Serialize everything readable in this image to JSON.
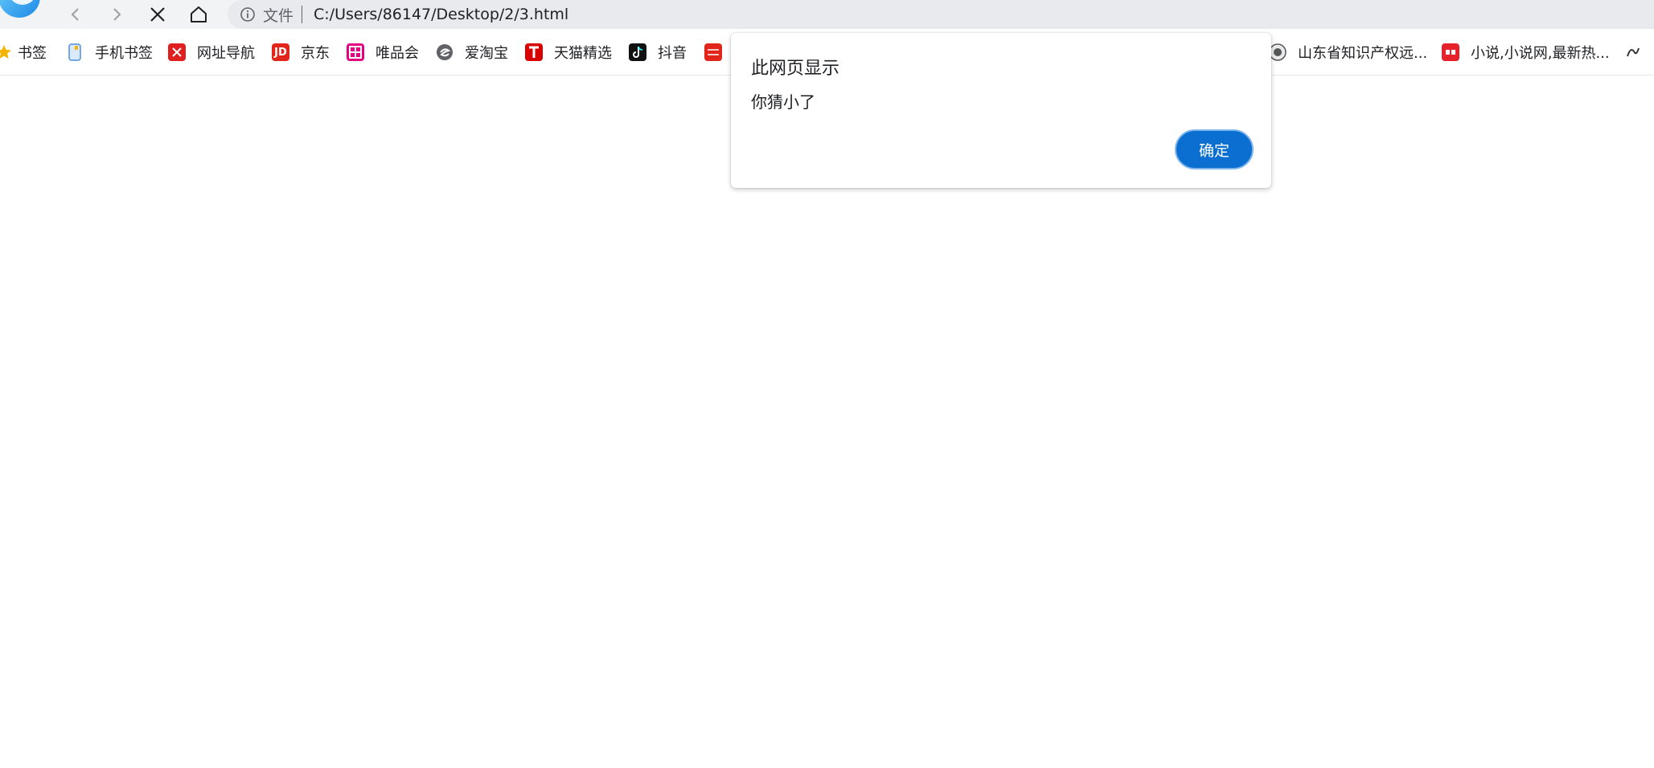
{
  "nav": {
    "address": {
      "scheme_label": "文件",
      "url": "C:/Users/86147/Desktop/2/3.html"
    },
    "icons": {
      "back": "back-arrow-icon",
      "forward": "forward-arrow-icon",
      "stop": "close-x-icon",
      "home": "home-icon",
      "info": "info-circle-icon"
    }
  },
  "bookmarks": [
    {
      "label": "书签",
      "icon": "star-icon",
      "color": "#f4b400"
    },
    {
      "label": "手机书签",
      "icon": "phone-icon",
      "color": "#4a90e2"
    },
    {
      "label": "网址导航",
      "icon": "nav-site-icon",
      "color": "#e02020"
    },
    {
      "label": "京东",
      "icon": "jd-logo-icon",
      "color": "#e1251b"
    },
    {
      "label": "唯品会",
      "icon": "vip-logo-icon",
      "color": "#e4007f"
    },
    {
      "label": "爱淘宝",
      "icon": "ai-taobao-icon",
      "color": "#5f6368"
    },
    {
      "label": "天猫精选",
      "icon": "tmall-logo-icon",
      "color": "#d80000"
    },
    {
      "label": "抖音",
      "icon": "douyin-logo-icon",
      "color": "#111111"
    },
    {
      "label": "",
      "icon": "dongfang-logo-icon",
      "color": "#e1251b"
    },
    {
      "label": "山东省知识产权远...",
      "icon": "emblem-icon",
      "color": "#555555"
    },
    {
      "label": "小说,小说网,最新热...",
      "icon": "qidian-logo-icon",
      "color": "#e6212a"
    },
    {
      "label": "",
      "icon": "partial-bookmark-icon",
      "color": "#333333"
    }
  ],
  "dialog": {
    "title": "此网页显示",
    "message": "你猜小了",
    "ok_label": "确定",
    "ok_color": "#0b6fd1"
  }
}
